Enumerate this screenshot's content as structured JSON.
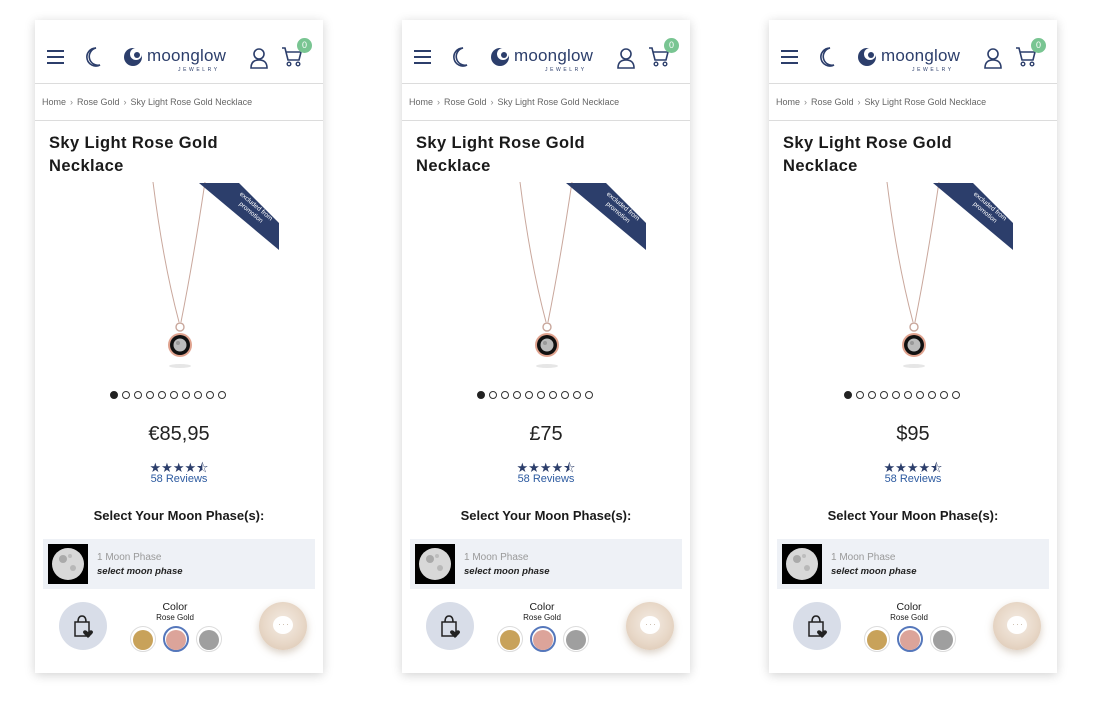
{
  "header": {
    "logo_text": "moonglow",
    "logo_subtext": "JEWELRY",
    "cart_count": "0"
  },
  "breadcrumb": [
    "Home",
    "Rose Gold",
    "Sky Light Rose Gold Necklace"
  ],
  "product": {
    "title": "Sky Light Rose Gold Necklace",
    "ribbon_text": "excluded from promotion",
    "stars": "★★★★⯪",
    "rating": 4.5,
    "reviews": "58 Reviews",
    "gallery_count": 10,
    "gallery_active": 1
  },
  "phase_section": {
    "title": "Select Your Moon Phase(s):",
    "line1": "1 Moon Phase",
    "line2": "select moon phase"
  },
  "color": {
    "label": "Color",
    "value": "Rose Gold",
    "swatches": [
      {
        "name": "gold",
        "color": "#c8a25a",
        "selected": false
      },
      {
        "name": "rose-gold",
        "color": "#dca49a",
        "selected": true
      },
      {
        "name": "silver",
        "color": "#9f9f9f",
        "selected": false
      }
    ]
  },
  "colors": {
    "brand_navy": "#2c3e6b",
    "cart_badge": "#79c592"
  },
  "variants": [
    {
      "price": "€85,95"
    },
    {
      "price": "£75"
    },
    {
      "price": "$95"
    }
  ]
}
